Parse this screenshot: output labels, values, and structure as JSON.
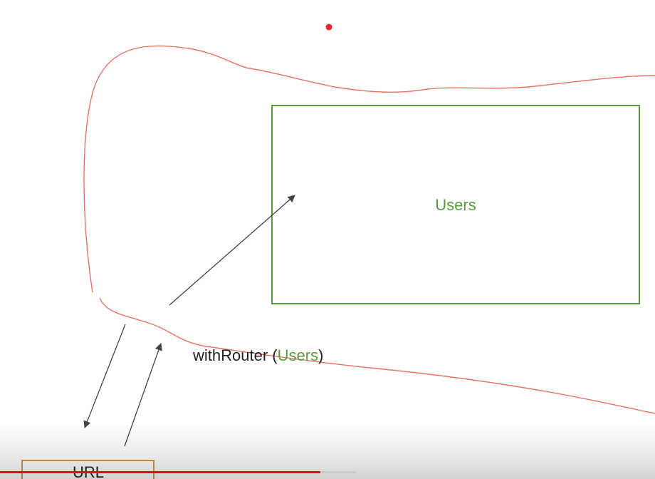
{
  "diagram": {
    "users_box_label": "Users",
    "hoc_prefix": "withRouter (",
    "hoc_argument": "Users",
    "hoc_suffix": ")",
    "url_box_label": "URL"
  },
  "colors": {
    "users_green": "#5a9a40",
    "outline_red": "#e57366",
    "url_orange": "#d9934a",
    "arrow_gray": "#444444",
    "pointer_red": "#e8232e",
    "progress_red": "#ff0000",
    "text_dark": "#222222"
  },
  "video_player": {
    "progress_fraction": 0.9
  }
}
